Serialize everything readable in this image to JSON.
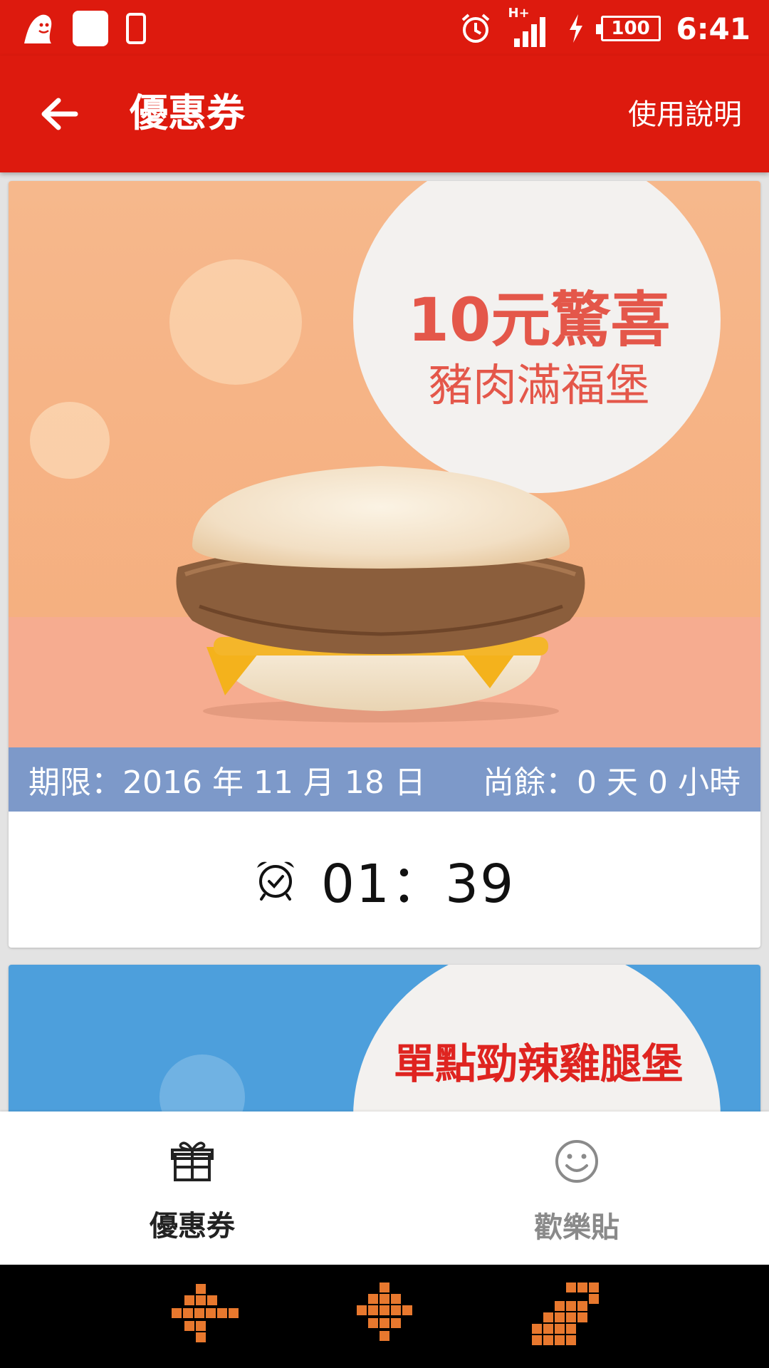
{
  "status_bar": {
    "time": "6:41",
    "battery": "100",
    "network": "H+",
    "icons": [
      "ghost-icon",
      "notification-square-icon",
      "phone-icon",
      "alarm-icon",
      "signal-icon",
      "charging-icon",
      "battery-icon"
    ]
  },
  "app_bar": {
    "title": "優惠券",
    "help_label": "使用說明",
    "back_icon": "arrow-left-icon"
  },
  "coupons": [
    {
      "headline": "10元驚喜",
      "product": "豬肉滿福堡",
      "expiry": "期限：2016 年 11 月 18 日",
      "remaining": "尚餘：0 天 0 小時",
      "timer": "01：39",
      "timer_icon": "alarm-clock-icon",
      "bg_color": "#f5ad7c",
      "band_color": "#7d99c9"
    },
    {
      "headline": "單點勁辣雞腿堡",
      "bg_color": "#4d9fdc"
    }
  ],
  "bottom_tabs": [
    {
      "label": "優惠券",
      "icon": "gift-icon",
      "active": true
    },
    {
      "label": "歡樂貼",
      "icon": "smiley-icon",
      "active": false
    }
  ],
  "nav_bar": {
    "buttons": [
      "back",
      "home",
      "recent"
    ]
  },
  "colors": {
    "brand_red": "#dd1a0e",
    "nav_orange": "#e8782e"
  }
}
